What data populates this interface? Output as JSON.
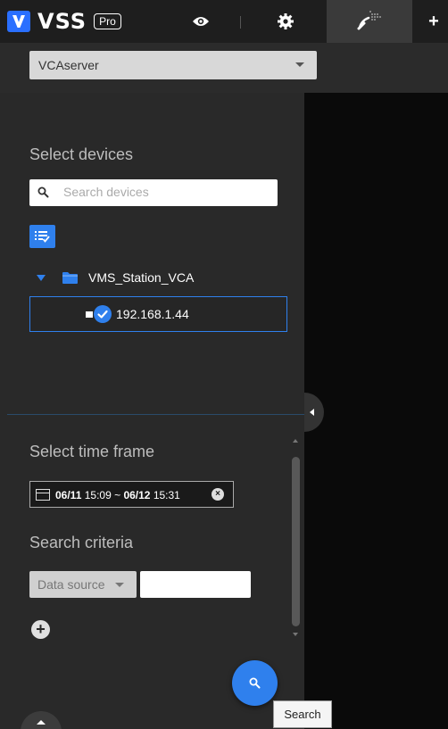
{
  "app": {
    "logo_text": "VSS",
    "logo_badge": "Pro"
  },
  "tabs": {
    "live": "eye-icon",
    "settings": "gear-icon",
    "active": "vca-search-icon",
    "add_label": "+"
  },
  "server": {
    "selected": "VCAserver"
  },
  "devices": {
    "title": "Select devices",
    "search_placeholder": "Search devices",
    "tree": {
      "group": "VMS_Station_VCA",
      "items": [
        {
          "label": "192.168.1.44",
          "checked": true
        }
      ]
    }
  },
  "timeframe": {
    "title": "Select time frame",
    "start_date": "06/11",
    "start_time": "15:09",
    "separator": "~",
    "end_date": "06/12",
    "end_time": "15:31"
  },
  "criteria": {
    "title": "Search criteria",
    "source_label": "Data source",
    "source_value": ""
  },
  "actions": {
    "search_tooltip": "Search"
  },
  "colors": {
    "accent": "#2f80ed",
    "panel": "#292929",
    "topbar": "#1e1e1e"
  }
}
